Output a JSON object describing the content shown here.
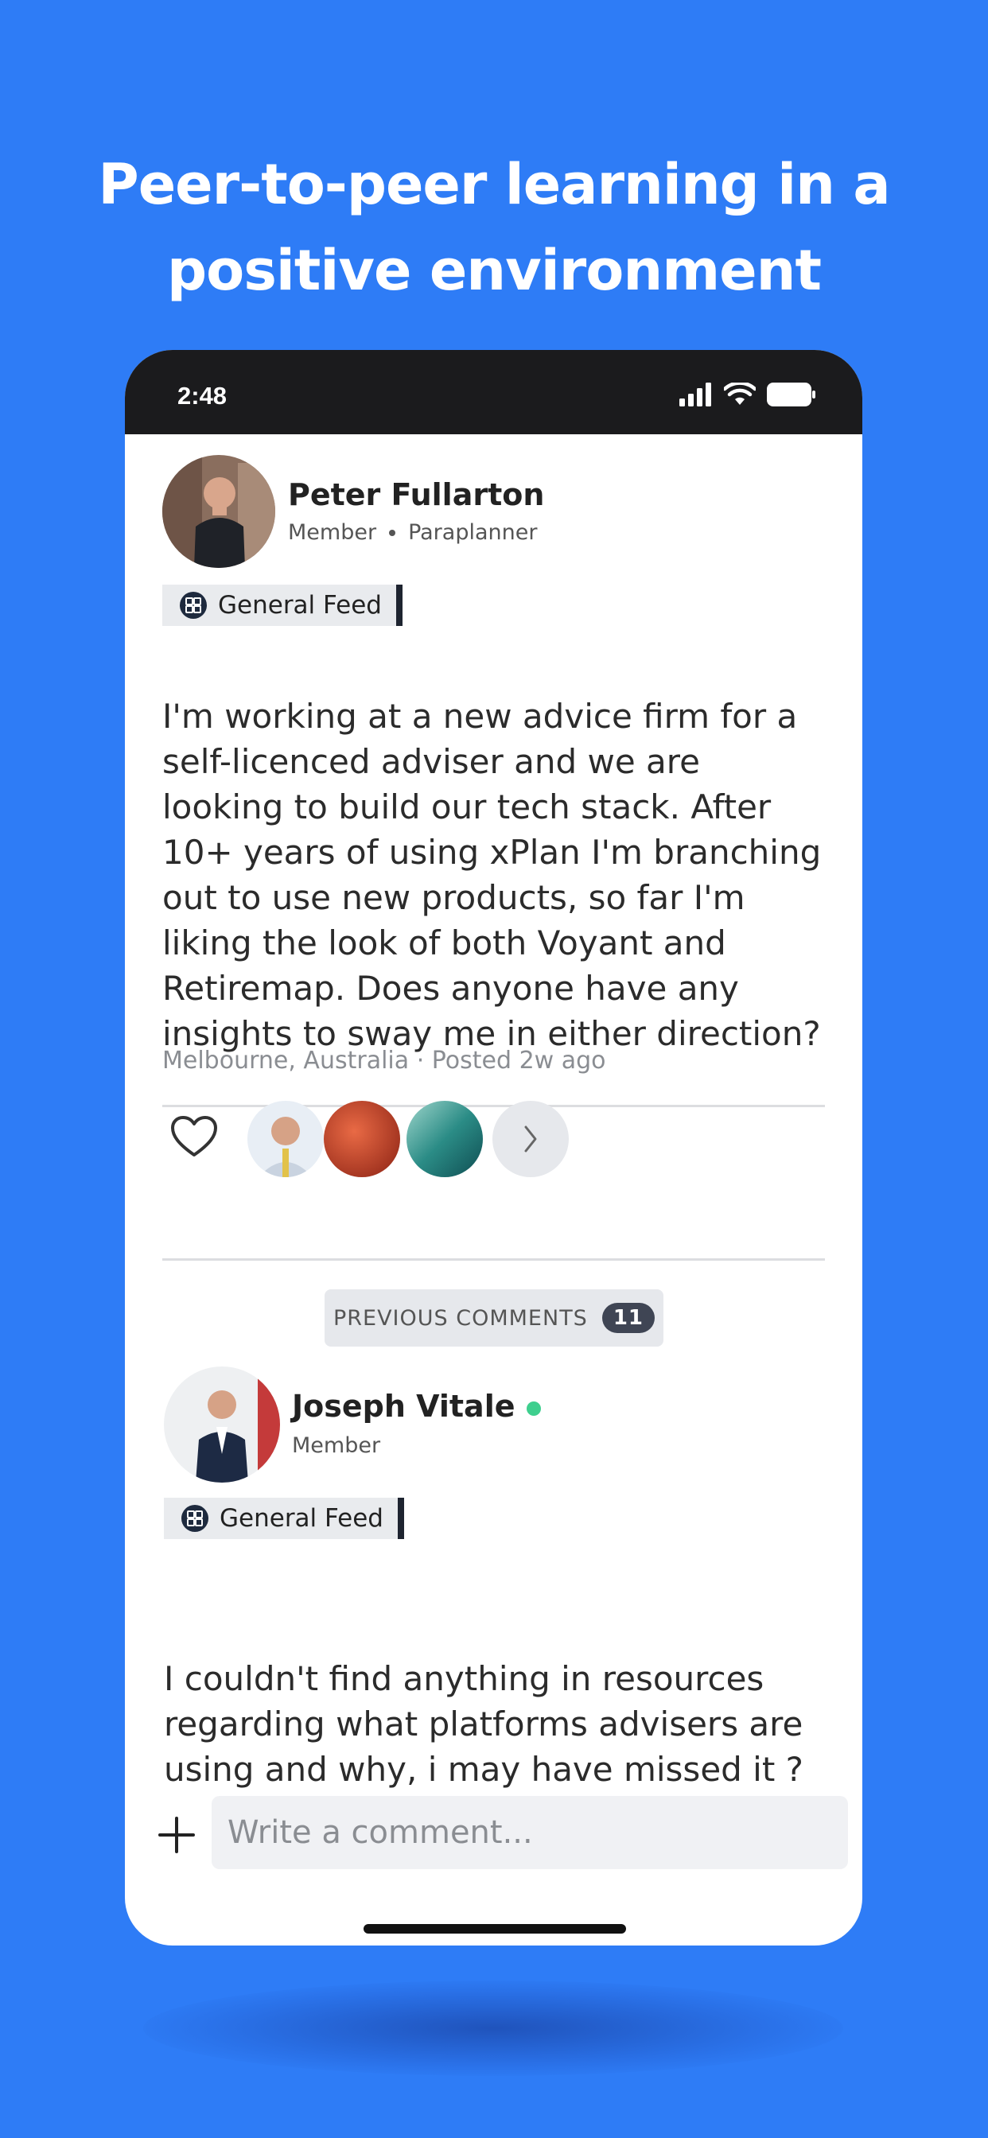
{
  "headline": {
    "line1": "Peer-to-peer learning in a",
    "line2": "positive environment"
  },
  "status_bar": {
    "time": "2:48"
  },
  "post": {
    "author_name": "Peter Fullarton",
    "author_role": "Member",
    "author_title": "Paraplanner",
    "feed": "General Feed",
    "body": "I'm working at a new advice firm for a self-licenced adviser and we are looking to build our tech stack. After 10+ years of using xPlan I'm branching out to use new products, so far I'm liking the look of both Voyant and Retiremap. Does anyone have any insights to sway me in either direction?",
    "location": "Melbourne, Australia",
    "posted": "Posted 2w ago"
  },
  "reactions": {
    "more_icon": "chevron-right-icon",
    "like_icon": "heart-outline-icon"
  },
  "comments": {
    "previous_label": "PREVIOUS COMMENTS",
    "previous_count": "11",
    "items": [
      {
        "author_name": "Joseph Vitale",
        "author_role": "Member",
        "online": true,
        "feed": "General Feed",
        "body": "I couldn't find anything in resources regarding what platforms advisers are using and why, i may have missed it ?"
      }
    ]
  },
  "composer": {
    "placeholder": "Write a comment..."
  },
  "colors": {
    "background": "#2e7cf6",
    "status_bar": "#1b1b1d",
    "online": "#3ecf8e",
    "badge": "#3f4554"
  }
}
